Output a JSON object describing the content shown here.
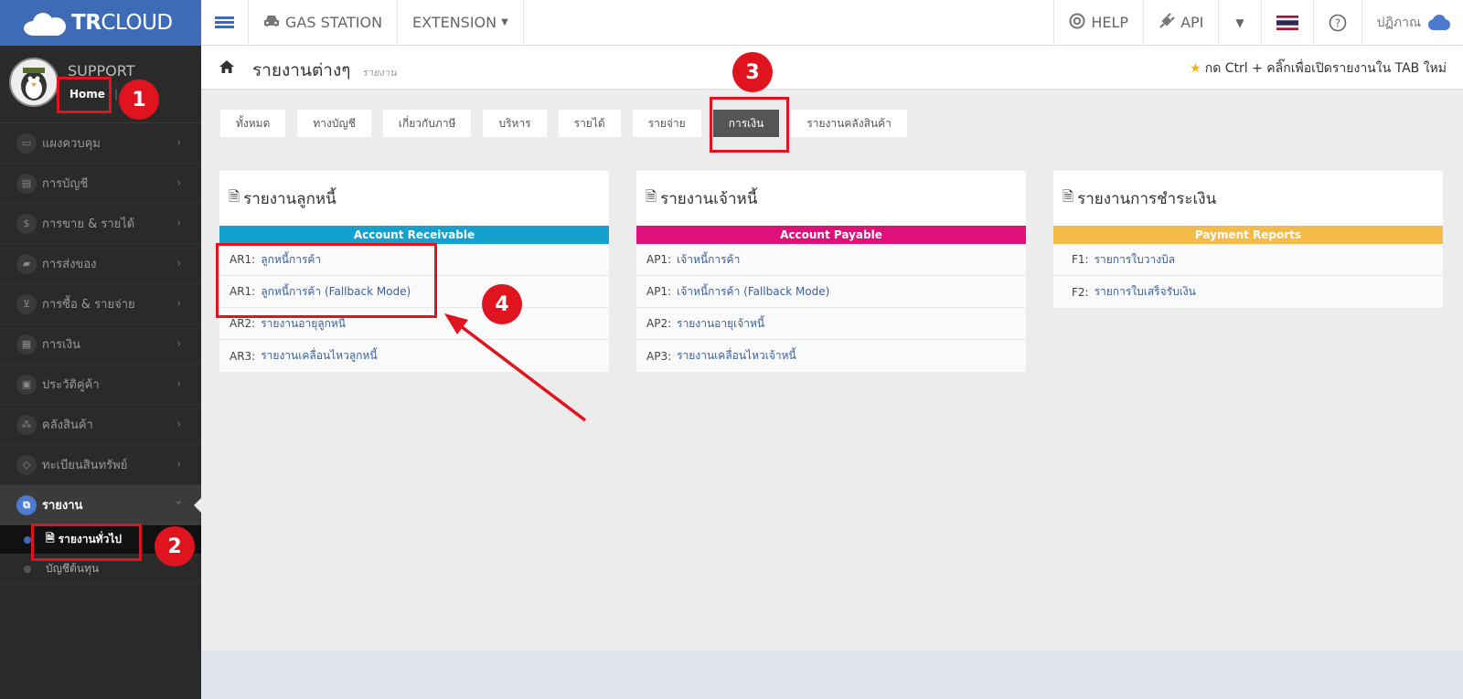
{
  "brand": {
    "bold": "TR",
    "rest": "CLOUD"
  },
  "topbar": {
    "gas_station": "GAS STATION",
    "extension": "EXTENSION",
    "help": "HELP",
    "api": "API",
    "user": "ปฏิภาณ"
  },
  "profile": {
    "name": "SUPPORT",
    "home": "Home",
    "sep": "|"
  },
  "sidebar": {
    "items": [
      {
        "label": "แผงควบคุม",
        "icon": "monitor-icon"
      },
      {
        "label": "การบัญชี",
        "icon": "book-icon"
      },
      {
        "label": "การขาย & รายได้",
        "icon": "dollar-icon"
      },
      {
        "label": "การส่งของ",
        "icon": "truck-icon"
      },
      {
        "label": "การซื้อ & รายจ่าย",
        "icon": "cart-icon"
      },
      {
        "label": "การเงิน",
        "icon": "calendar-icon"
      },
      {
        "label": "ประวัติคู่ค้า",
        "icon": "contact-icon"
      },
      {
        "label": "คลังสินค้า",
        "icon": "boxes-icon"
      },
      {
        "label": "ทะเบียนสินทรัพย์",
        "icon": "diamond-icon"
      },
      {
        "label": "รายงาน",
        "icon": "report-icon"
      }
    ],
    "sub_items": [
      {
        "label": "รายงานทั่วไป"
      },
      {
        "label": "บัญชีต้นทุน"
      }
    ]
  },
  "page": {
    "title": "รายงานต่างๆ",
    "subtitle": "รายงาน",
    "hint": "กด Ctrl + คลิ๊กเพื่อเปิดรายงานใน TAB ใหม่"
  },
  "tabs": [
    "ทั้งหมด",
    "ทางบัญชี",
    "เกี่ยวกับภาษี",
    "บริหาร",
    "รายได้",
    "รายจ่าย",
    "การเงิน",
    "รายงานคลังสินค้า"
  ],
  "panels": [
    {
      "title": "รายงานลูกหนี้",
      "band": "Account Receivable",
      "color": "#13a1cf",
      "rows": [
        {
          "code": "AR1:",
          "label": "ลูกหนี้การค้า"
        },
        {
          "code": "AR1:",
          "label": "ลูกหนี้การค้า (Fallback Mode)"
        },
        {
          "code": "AR2:",
          "label": "รายงานอายุลูกหนี้"
        },
        {
          "code": "AR3:",
          "label": "รายงานเคลื่อนไหวลูกหนี้"
        }
      ]
    },
    {
      "title": "รายงานเจ้าหนี้",
      "band": "Account Payable",
      "color": "#e0107a",
      "rows": [
        {
          "code": "AP1:",
          "label": "เจ้าหนี้การค้า"
        },
        {
          "code": "AP1:",
          "label": "เจ้าหนี้การค้า (Fallback Mode)"
        },
        {
          "code": "AP2:",
          "label": "รายงานอายุเจ้าหนี้"
        },
        {
          "code": "AP3:",
          "label": "รายงานเคลื่อนไหวเจ้าหนี้"
        }
      ]
    },
    {
      "title": "รายงานการชำระเงิน",
      "band": "Payment Reports",
      "color": "#f5bb48",
      "rows": [
        {
          "code": "F1:",
          "label": "รายการใบวางบิล"
        },
        {
          "code": "F2:",
          "label": "รายการใบเสร็จรับเงิน"
        }
      ]
    }
  ],
  "annotations": [
    "1",
    "2",
    "3",
    "4"
  ],
  "colors": {
    "accent": "#3d6bb5",
    "annotation": "#e0141e",
    "active_tab": "#555555"
  }
}
